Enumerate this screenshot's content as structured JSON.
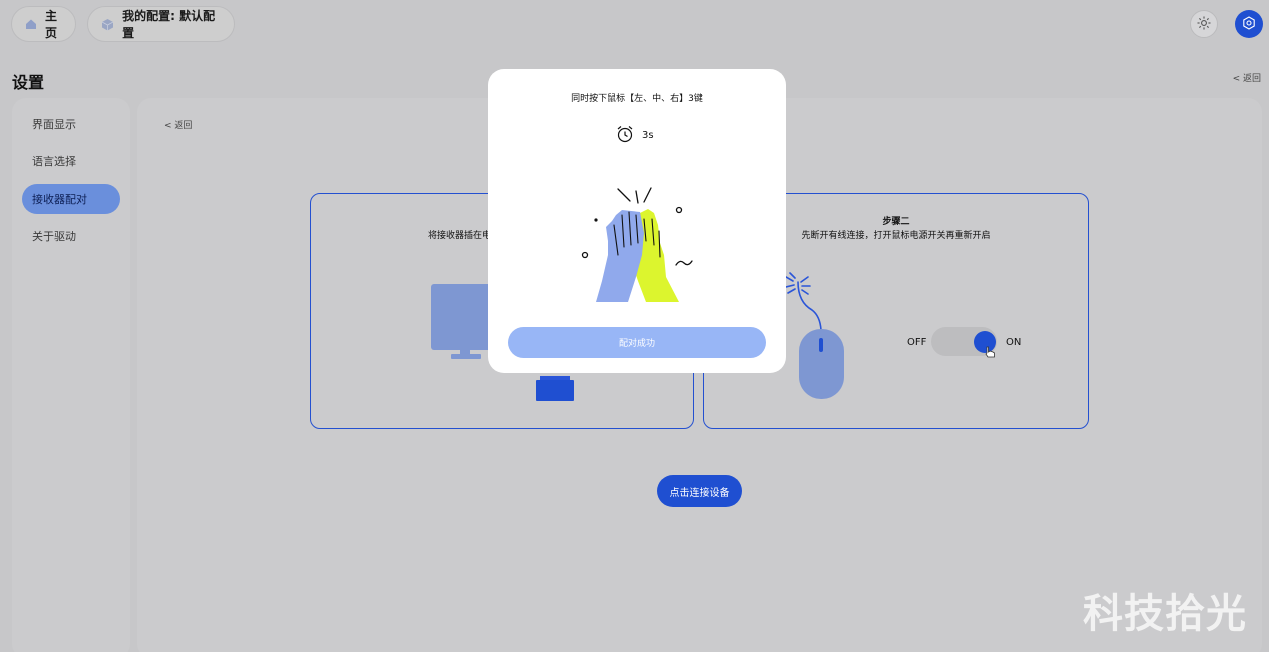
{
  "topbar": {
    "home_label": "主页",
    "profile_label": "我的配置: 默认配置",
    "brightness_icon": "sun-icon",
    "settings_icon": "gear-icon",
    "accent": "#1f4fd1"
  },
  "page": {
    "title": "设置",
    "back_label": "< 返回"
  },
  "sidebar": {
    "items": [
      {
        "label": "界面显示",
        "active": false
      },
      {
        "label": "语言选择",
        "active": false
      },
      {
        "label": "接收器配对",
        "active": true
      },
      {
        "label": "关于驱动",
        "active": false
      }
    ]
  },
  "main": {
    "back_label": "< 返回",
    "step1": {
      "desc": "将接收器插在电"
    },
    "step2": {
      "title": "步骤二",
      "desc": "先断开有线连接，打开鼠标电源开关再重新开启",
      "off_label": "OFF",
      "on_label": "ON"
    },
    "connect_button": "点击连接设备"
  },
  "modal": {
    "title": "同时按下鼠标【左、中、右】3键",
    "timer": "3s",
    "success_button": "配对成功"
  },
  "watermark": "科技拾光"
}
